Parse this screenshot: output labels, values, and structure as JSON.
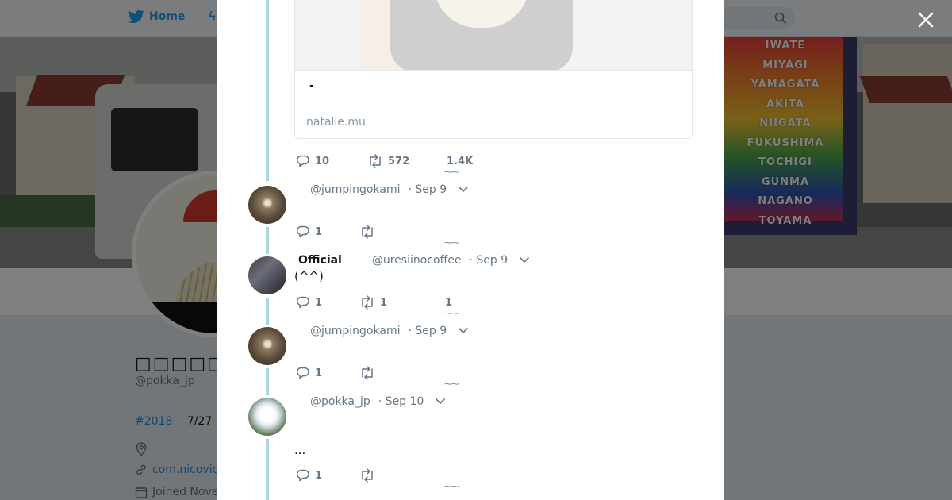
{
  "nav": {
    "home_label": "Home"
  },
  "banner": {
    "truck_text": [
      "IWATE",
      "MIYAGI",
      "YAMAGATA",
      "AKITA",
      "NIIGATA",
      "FUKUSHIMA",
      "TOCHIGI",
      "GUNMA",
      "NAGANO",
      "TOYAMA"
    ]
  },
  "profile": {
    "name": "□□□□□□",
    "handle": "@pokka_jp",
    "hashtag": "#2018",
    "bio_date": "7/27",
    "link_text": "com.nicovid",
    "joined_text": "Joined Nove"
  },
  "modal": {
    "card": {
      "title": "-",
      "domain": "natalie.mu"
    },
    "card_stats": {
      "replies": "10",
      "retweets": "572",
      "likes": "1.4K"
    },
    "tweets": [
      {
        "name": "",
        "handle": "@jumpingokami",
        "date": "· Sep 9",
        "text": "",
        "replies": "1",
        "retweets": "",
        "likes": ""
      },
      {
        "name": "Official",
        "handle": "@uresiinocoffee",
        "date": "· Sep 9",
        "text": "(^^)",
        "replies": "1",
        "retweets": "1",
        "likes": "1"
      },
      {
        "name": "",
        "handle": "@jumpingokami",
        "date": "· Sep 9",
        "text": "",
        "replies": "1",
        "retweets": "",
        "likes": ""
      },
      {
        "name": "",
        "handle": "@pokka_jp",
        "date": "· Sep 10",
        "text": "...",
        "replies": "1",
        "retweets": "",
        "likes": ""
      }
    ]
  },
  "colors": {
    "accent": "#1da1f2",
    "thread_line": "#a9d6e5",
    "muted": "#657786"
  }
}
